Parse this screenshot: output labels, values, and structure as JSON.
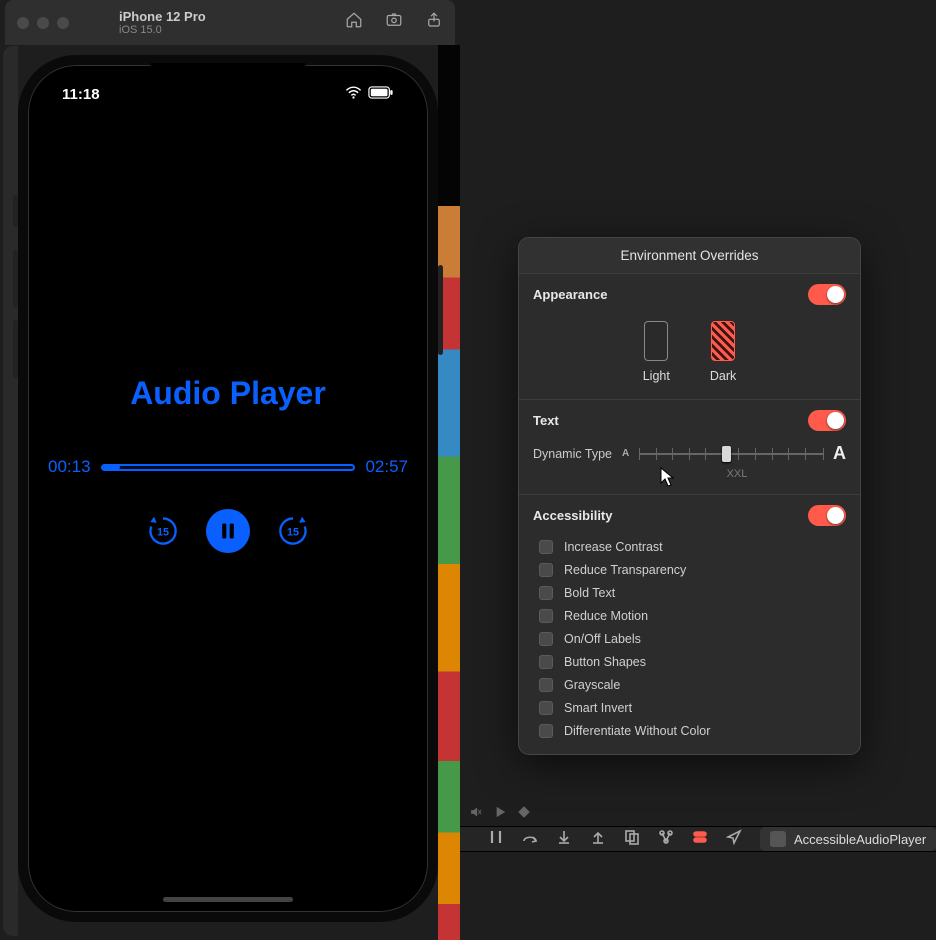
{
  "simulator": {
    "device": "iPhone 12 Pro",
    "os": "iOS 15.0",
    "status_time": "11:18"
  },
  "app": {
    "title": "Audio Player",
    "elapsed": "00:13",
    "remaining": "02:57",
    "skip_back": "15",
    "skip_fwd": "15"
  },
  "popover": {
    "title": "Environment Overrides",
    "appearance": {
      "label": "Appearance",
      "light": "Light",
      "dark": "Dark"
    },
    "text": {
      "label": "Text",
      "dynamic_type_label": "Dynamic Type",
      "current": "XXL"
    },
    "accessibility": {
      "label": "Accessibility",
      "options": [
        "Increase Contrast",
        "Reduce Transparency",
        "Bold Text",
        "Reduce Motion",
        "On/Off Labels",
        "Button Shapes",
        "Grayscale",
        "Smart Invert",
        "Differentiate Without Color"
      ]
    }
  },
  "toolbar": {
    "scheme": "AccessibleAudioPlayer"
  }
}
